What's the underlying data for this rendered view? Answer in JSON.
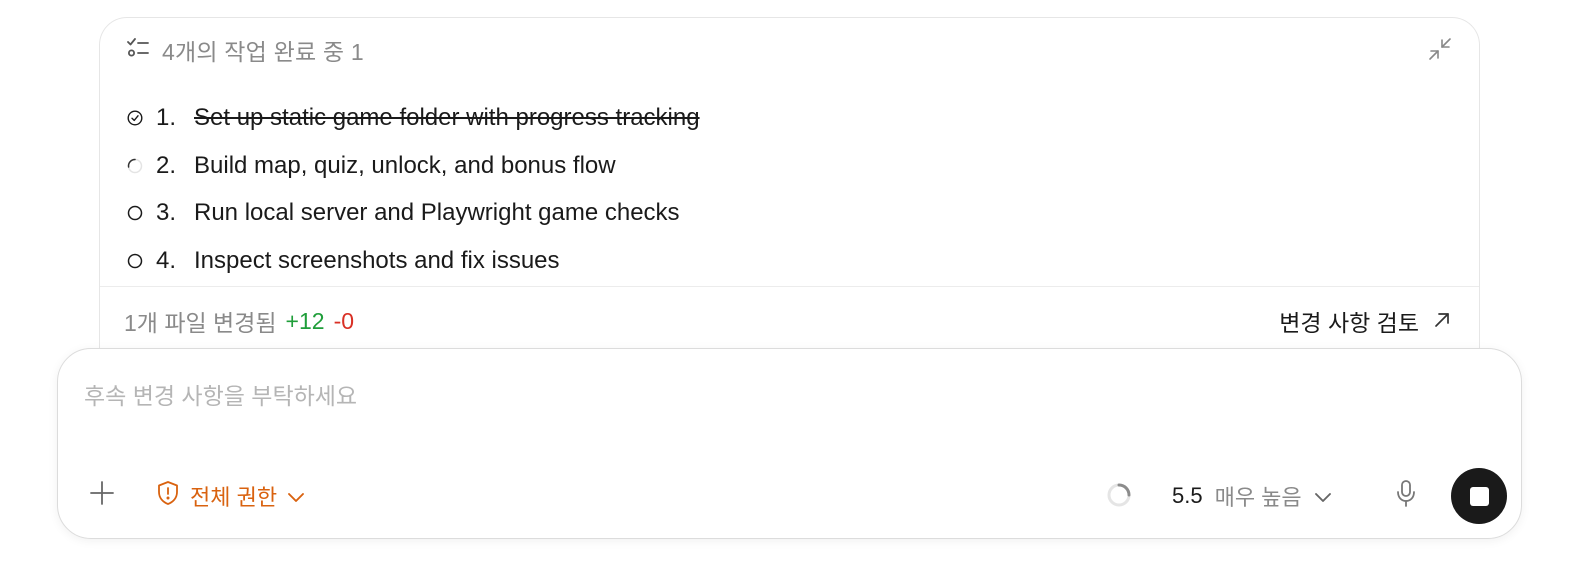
{
  "tasks_panel": {
    "title": "4개의 작업 완료 중 1",
    "header_icon": "checklist-icon",
    "collapse_icon": "collapse-arrows-icon",
    "tasks": [
      {
        "number": "1.",
        "text": "Set up static game folder with progress tracking",
        "status": "done",
        "icon": "check-circle-icon"
      },
      {
        "number": "2.",
        "text": "Build map, quiz, unlock, and bonus flow",
        "status": "in-progress",
        "icon": "spinner-icon"
      },
      {
        "number": "3.",
        "text": "Run local server and Playwright game checks",
        "status": "pending",
        "icon": "empty-circle-icon"
      },
      {
        "number": "4.",
        "text": "Inspect screenshots and fix issues",
        "status": "pending",
        "icon": "empty-circle-icon"
      }
    ],
    "changes": {
      "summary": "1개 파일 변경됨",
      "additions": "+12",
      "deletions": "-0",
      "review_label": "변경 사항 검토",
      "review_icon": "arrow-up-right-icon"
    }
  },
  "composer": {
    "placeholder": "후속 변경 사항을 부탁하세요",
    "value": "",
    "add_icon": "plus-icon",
    "permission": {
      "label": "전체 권한",
      "icon": "shield-alert-icon",
      "color": "#d9620f"
    },
    "model": {
      "version": "5.5",
      "effort": "매우 높음"
    },
    "mic_icon": "microphone-icon",
    "stop_icon": "stop-icon"
  },
  "colors": {
    "additions": "#1f9e3a",
    "deletions": "#d93025",
    "accent": "#d9620f",
    "stop_button": "#1a1a1a"
  }
}
